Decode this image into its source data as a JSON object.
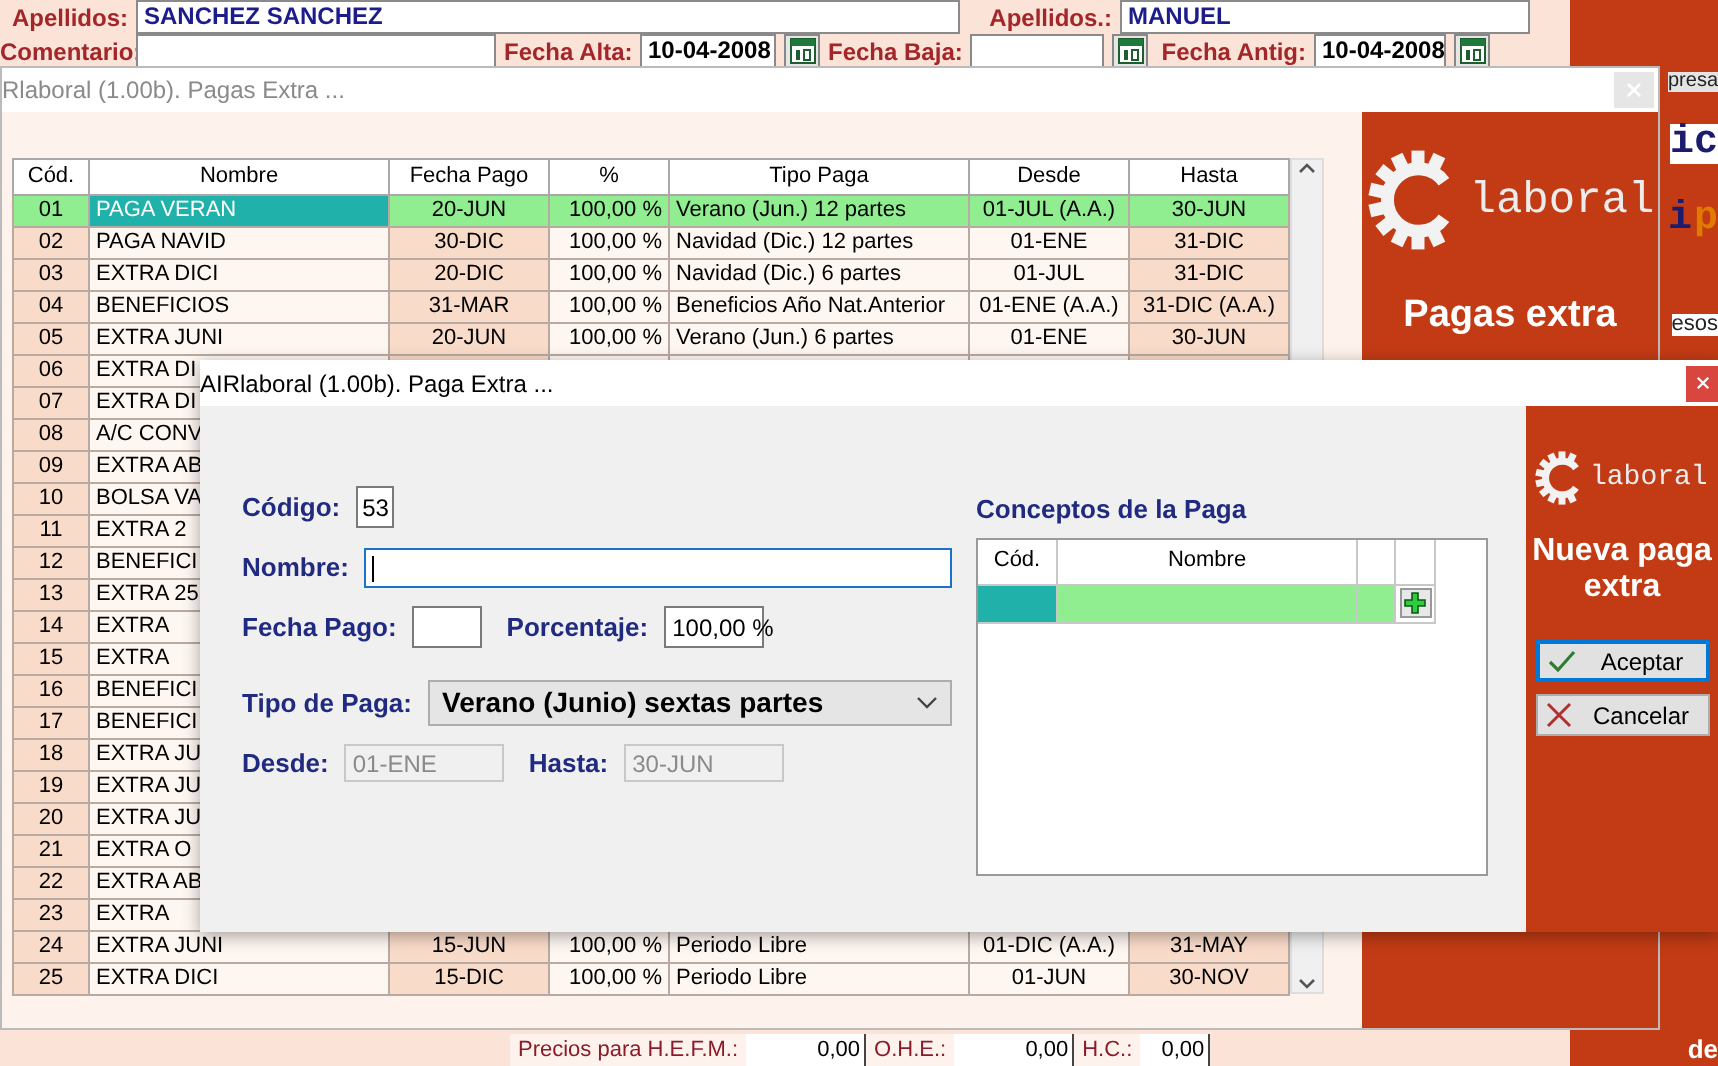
{
  "background_window": {
    "name_fields": [
      {
        "label": "Apellidos:",
        "value": "SANCHEZ SANCHEZ",
        "calendar": false
      },
      {
        "label": "Apellidos.:",
        "value": "MANUEL",
        "calendar": false
      }
    ],
    "date_fields": [
      {
        "label": "Comentario:",
        "calendar": false
      },
      {
        "label": "Fecha Alta:",
        "value": "10-04-2008",
        "calendar": true
      },
      {
        "label": "Fecha Baja:",
        "calendar": true
      },
      {
        "label": "Fecha Antig:",
        "value": "10-04-2008",
        "calendar": true
      }
    ],
    "side_fragments": [
      "presa",
      "ic",
      "i",
      "p",
      "esos",
      "de"
    ],
    "footer": [
      {
        "kind": "label",
        "text": "Precios para H.E.F.M.:"
      },
      {
        "kind": "value",
        "text": "0,00"
      },
      {
        "kind": "label",
        "text": "O.H.E.:"
      },
      {
        "kind": "value",
        "text": "0,00"
      },
      {
        "kind": "label",
        "text": "H.C.:"
      },
      {
        "kind": "value",
        "text": "0,00"
      }
    ]
  },
  "list_window": {
    "title": "Rlaboral (1.00b). Pagas Extra ...",
    "columns": [
      "Cód.",
      "Nombre",
      "Fecha Pago",
      "%",
      "Tipo Paga",
      "Desde",
      "Hasta"
    ],
    "rows": [
      {
        "cells": [
          "01",
          "PAGA VERAN",
          "20-JUN",
          "100,00 %",
          "Verano (Jun.) 12 partes",
          "01-JUL (A.A.)",
          "30-JUN"
        ],
        "selected": true
      },
      {
        "cells": [
          "02",
          "PAGA NAVID",
          "30-DIC",
          "100,00 %",
          "Navidad (Dic.) 12 partes",
          "01-ENE",
          "31-DIC"
        ],
        "selected": false
      },
      {
        "cells": [
          "03",
          "EXTRA DICI",
          "20-DIC",
          "100,00 %",
          "Navidad (Dic.) 6 partes",
          "01-JUL",
          "31-DIC"
        ],
        "selected": false
      },
      {
        "cells": [
          "04",
          "BENEFICIOS",
          "31-MAR",
          "100,00 %",
          "Beneficios Año Nat.Anterior",
          "01-ENE (A.A.)",
          "31-DIC (A.A.)"
        ],
        "selected": false
      },
      {
        "cells": [
          "05",
          "EXTRA JUNI",
          "20-JUN",
          "100,00 %",
          "Verano (Jun.) 6 partes",
          "01-ENE",
          "30-JUN"
        ],
        "selected": false
      },
      {
        "cells": [
          "06",
          "EXTRA DI"
        ],
        "selected": false
      },
      {
        "cells": [
          "07",
          "EXTRA DI"
        ],
        "selected": false
      },
      {
        "cells": [
          "08",
          "A/C CONV"
        ],
        "selected": false
      },
      {
        "cells": [
          "09",
          "EXTRA AB"
        ],
        "selected": false
      },
      {
        "cells": [
          "10",
          "BOLSA VA"
        ],
        "selected": false
      },
      {
        "cells": [
          "11",
          "EXTRA 2"
        ],
        "selected": false
      },
      {
        "cells": [
          "12",
          "BENEFICI"
        ],
        "selected": false
      },
      {
        "cells": [
          "13",
          "EXTRA 25"
        ],
        "selected": false
      },
      {
        "cells": [
          "14",
          "EXTRA"
        ],
        "selected": false
      },
      {
        "cells": [
          "15",
          "EXTRA"
        ],
        "selected": false
      },
      {
        "cells": [
          "16",
          "BENEFICI"
        ],
        "selected": false
      },
      {
        "cells": [
          "17",
          "BENEFICI"
        ],
        "selected": false
      },
      {
        "cells": [
          "18",
          "EXTRA JU"
        ],
        "selected": false
      },
      {
        "cells": [
          "19",
          "EXTRA JU"
        ],
        "selected": false
      },
      {
        "cells": [
          "20",
          "EXTRA JU"
        ],
        "selected": false
      },
      {
        "cells": [
          "21",
          "EXTRA O"
        ],
        "selected": false
      },
      {
        "cells": [
          "22",
          "EXTRA AB"
        ],
        "selected": false
      },
      {
        "cells": [
          "23",
          "EXTRA"
        ],
        "selected": false
      },
      {
        "cells": [
          "24",
          "EXTRA JUNI",
          "15-JUN",
          "100,00 %",
          "Periodo Libre",
          "01-DIC (A.A.)",
          "31-MAY"
        ],
        "selected": false
      },
      {
        "cells": [
          "25",
          "EXTRA DICI",
          "15-DIC",
          "100,00 %",
          "Periodo Libre",
          "01-JUN",
          "30-NOV"
        ],
        "selected": false
      }
    ],
    "panel": {
      "logo": "laboral",
      "heading": "Pagas extra"
    }
  },
  "dialog": {
    "title": "AIRlaboral (1.00b). Paga Extra ...",
    "codigo": {
      "label": "Código:",
      "value": "53"
    },
    "nombre": {
      "label": "Nombre:",
      "focused": true
    },
    "fecha_pago": {
      "label": "Fecha Pago:"
    },
    "porcentaje": {
      "label": "Porcentaje:",
      "value": "100,00 %"
    },
    "tipo_paga": {
      "label": "Tipo de Paga:",
      "value": "Verano (Junio) sextas partes"
    },
    "desde": {
      "label": "Desde:",
      "value": "01-ENE",
      "disabled": true
    },
    "hasta": {
      "label": "Hasta:",
      "value": "30-JUN",
      "disabled": true
    },
    "conceptos": {
      "title": "Conceptos de la Paga",
      "columns": [
        "Cód.",
        "Nombre"
      ],
      "rows": [
        {
          "selected": true
        }
      ]
    },
    "panel": {
      "logo": "laboral",
      "heading": "Nueva paga extra",
      "buttons": [
        {
          "label": "Aceptar",
          "kind": "accept",
          "focused": true
        },
        {
          "label": "Cancelar",
          "kind": "cancel",
          "focused": false
        }
      ]
    }
  }
}
